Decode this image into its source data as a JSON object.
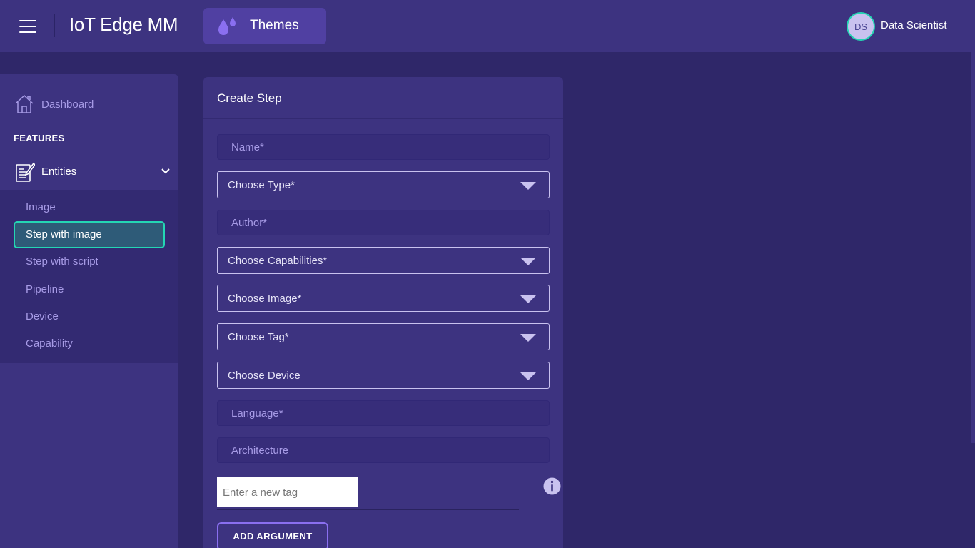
{
  "app": {
    "title": "IoT Edge MM"
  },
  "header": {
    "themes_label": "Themes",
    "user": {
      "initials": "DS",
      "name": "Data Scientist"
    }
  },
  "colors": {
    "accent": "#24d6b4",
    "background": "#2f2769",
    "panel": "#3d3380",
    "button_border": "#8a6ff0"
  },
  "sidebar": {
    "dashboard_label": "Dashboard",
    "section_label": "FEATURES",
    "entities_label": "Entities",
    "items": [
      {
        "label": "Image"
      },
      {
        "label": "Step with image",
        "active": true
      },
      {
        "label": "Step with script"
      },
      {
        "label": "Pipeline"
      },
      {
        "label": "Device"
      },
      {
        "label": "Capability"
      }
    ]
  },
  "form": {
    "title": "Create Step",
    "name_placeholder": "Name*",
    "type_label": "Choose Type*",
    "author_placeholder": "Author*",
    "capabilities_label": "Choose Capabilities*",
    "image_label": "Choose Image*",
    "tag_label": "Choose Tag*",
    "device_label": "Choose Device",
    "language_placeholder": "Language*",
    "architecture_placeholder": "Architecture",
    "new_tag_placeholder": "Enter a new tag",
    "add_argument_label": "ADD ARGUMENT"
  }
}
